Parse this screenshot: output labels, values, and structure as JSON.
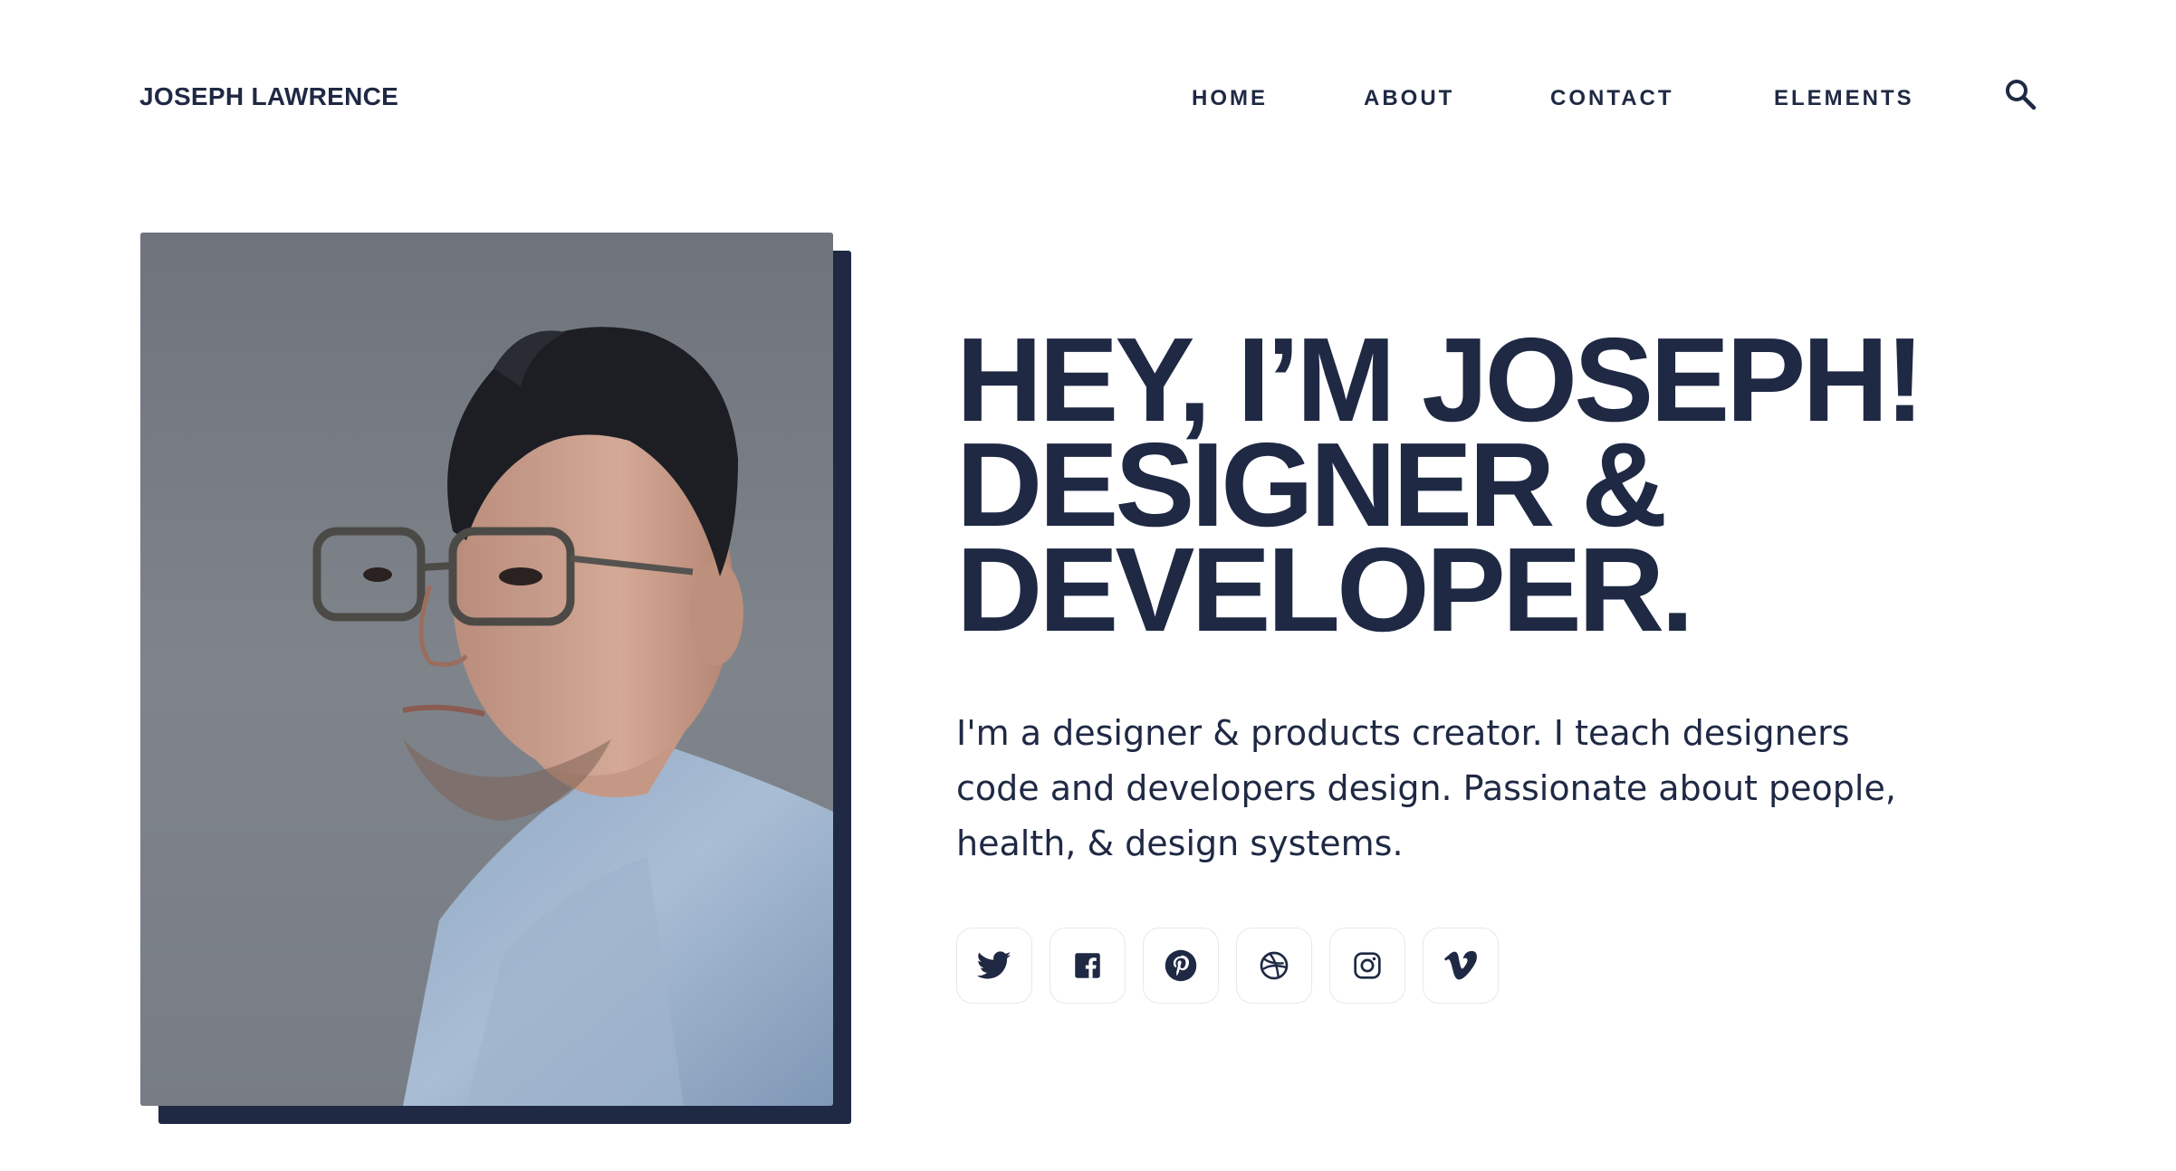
{
  "header": {
    "logo_text": "JOSEPH LAWRENCE",
    "nav": [
      {
        "label": "HOME"
      },
      {
        "label": "ABOUT"
      },
      {
        "label": "CONTACT"
      },
      {
        "label": "ELEMENTS"
      }
    ],
    "search_icon": "search-icon"
  },
  "hero": {
    "headline_lines": [
      "HEY, I’M JOSEPH!",
      "DESIGNER &",
      "DEVELOPER."
    ],
    "bio": "I'm a designer & products creator. I teach designers code and developers design. Passionate about people, health, & design systems.",
    "portrait": "portrait-photo"
  },
  "social": [
    {
      "icon": "twitter-icon"
    },
    {
      "icon": "facebook-icon"
    },
    {
      "icon": "pinterest-icon"
    },
    {
      "icon": "dribbble-icon"
    },
    {
      "icon": "instagram-icon"
    },
    {
      "icon": "vimeo-icon"
    }
  ],
  "colors": {
    "text": "#1f2944",
    "accent_shadow": "#1f2944",
    "background": "#ffffff",
    "button_border": "#e6e8ee"
  }
}
